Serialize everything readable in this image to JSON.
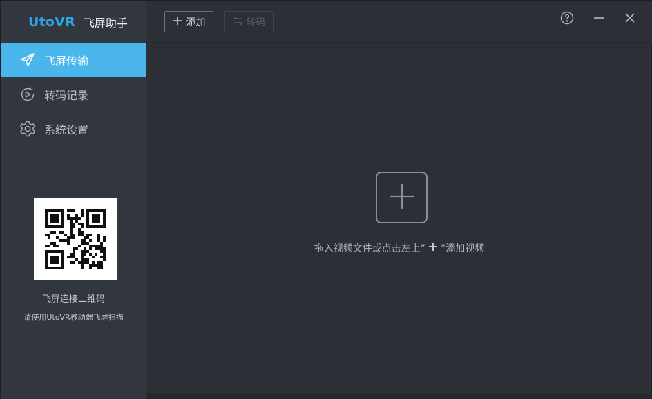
{
  "brand": {
    "logo": "UtoVR",
    "name": "飞屏助手"
  },
  "sidebar": {
    "items": [
      {
        "label": "飞屏传输",
        "icon": "paper-plane-icon",
        "active": true
      },
      {
        "label": "转码记录",
        "icon": "convert-history-icon",
        "active": false
      },
      {
        "label": "系统设置",
        "icon": "gear-icon",
        "active": false
      }
    ],
    "qr": {
      "title": "飞屏连接二维码",
      "subtitle": "请使用UtoVR移动端飞屏扫描"
    }
  },
  "toolbar": {
    "add_label": "添加",
    "convert_label": "转码",
    "help_icon": "help-icon",
    "minimize_icon": "minimize-icon",
    "close_icon": "close-icon"
  },
  "main": {
    "hint_before": "拖入视频文件或点击左上”",
    "hint_after": "”添加视频"
  },
  "colors": {
    "accent": "#4bb6ec",
    "logo": "#2ea4e6",
    "background": "#2c2f36",
    "sidebar": "#32363e"
  }
}
